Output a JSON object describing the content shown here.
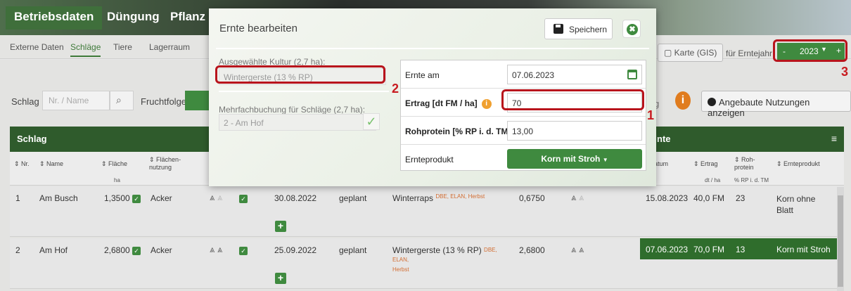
{
  "main_tabs": [
    "Betriebsdaten",
    "Düngung",
    "Pflanz"
  ],
  "sub_nav": [
    "Externe Daten",
    "Schläge",
    "Tiere",
    "Lagerraum"
  ],
  "filter": {
    "schlag_label": "Schlag",
    "schlag_placeholder": "Nr. / Name",
    "fruchtfolge_label": "Fruchtfolge"
  },
  "right_controls": {
    "karte_label": "Karte (GIS)",
    "fuer_erntejahr_label": "für Erntejahr",
    "year_minus": "-",
    "year_value": "2023",
    "year_plus": "+",
    "angebaute_label": "Angebaute Nutzungen anzeigen",
    "partial_char": "g"
  },
  "table": {
    "schlag_header": "Schlag",
    "ernte_header_partial": "nte",
    "columns": {
      "nr": "Nr.",
      "name": "Name",
      "flaeche": "Fläche",
      "flaechen_nutzung": "Flächen-\nnutzung",
      "flaeche_unit": "ha",
      "datum_partial": "atum",
      "ertrag": "Ertrag",
      "ertrag_unit": "dt / ha",
      "rohprotein": "Roh-\nprotein",
      "rohprotein_unit": "% RP i. d. TM",
      "ernteprodukt": "Ernteprodukt"
    },
    "rows": [
      {
        "nr": "1",
        "name": "Am Busch",
        "flaeche": "1,3500",
        "nutzung": "Acker",
        "date": "30.08.2022",
        "status": "geplant",
        "kultur": "Winterraps",
        "tags": "DBE, ELAN, Herbst",
        "area": "0,6750",
        "ernte_datum": "15.08.2023",
        "ertrag": "40,0 FM",
        "rp": "23",
        "produkt": "Korn ohne Blatt"
      },
      {
        "nr": "2",
        "name": "Am Hof",
        "flaeche": "2,6800",
        "nutzung": "Acker",
        "date": "25.09.2022",
        "status": "geplant",
        "kultur": "Wintergerste (13 % RP)",
        "tags": "DBE, ELAN,",
        "tags2": "Herbst",
        "area": "2,6800",
        "ernte_datum": "07.06.2023",
        "ertrag": "70,0 FM",
        "rp": "13",
        "produkt": "Korn mit Stroh"
      }
    ]
  },
  "modal": {
    "title": "Ernte bearbeiten",
    "save_label": "Speichern",
    "close_symbol": "✖",
    "kultur_label": "Ausgewählte Kultur (2,7 ha):",
    "kultur_value": "Wintergerste (13 % RP)",
    "mehrfach_label": "Mehrfachbuchung für Schläge (2,7 ha):",
    "mehrfach_value": "2 - Am Hof",
    "ernte_am_label": "Ernte am",
    "ernte_am_value": "07.06.2023",
    "ertrag_label": "Ertrag [dt FM / ha]",
    "ertrag_value": "70",
    "rohprotein_label": "Rohprotein [% RP i. d. TM]",
    "rohprotein_value": "13,00",
    "ernteprodukt_label": "Ernteprodukt",
    "ernteprodukt_value": "Korn mit Stroh"
  },
  "annotations": [
    "1",
    "2",
    "3"
  ],
  "colors": {
    "green_primary": "#3f8a3f",
    "green_dark": "#2f5b2c",
    "highlight_red": "#b8141c",
    "tag_orange": "#d26d32"
  }
}
